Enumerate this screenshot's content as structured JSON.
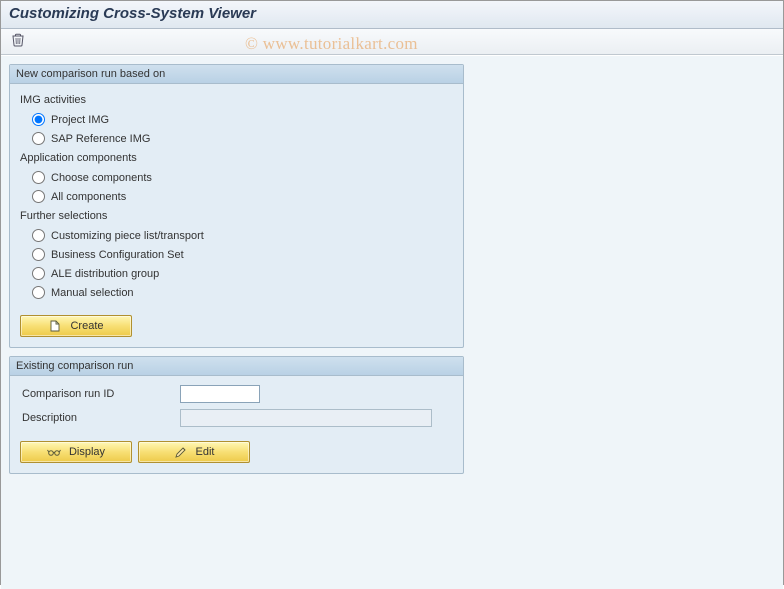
{
  "title": "Customizing Cross-System Viewer",
  "watermark": "© www.tutorialkart.com",
  "toolbar": {
    "delete_tooltip": "Delete"
  },
  "panels": {
    "new_run": {
      "header": "New comparison run based on",
      "groups": {
        "img_activities": {
          "label": "IMG activities",
          "options": {
            "project_img": "Project IMG",
            "sap_ref_img": "SAP Reference IMG"
          }
        },
        "app_components": {
          "label": "Application components",
          "options": {
            "choose": "Choose components",
            "all": "All components"
          }
        },
        "further": {
          "label": "Further selections",
          "options": {
            "piece_list": "Customizing piece list/transport",
            "bc_set": "Business Configuration Set",
            "ale_group": "ALE distribution group",
            "manual": "Manual selection"
          }
        }
      },
      "create_button": "Create"
    },
    "existing_run": {
      "header": "Existing comparison run",
      "fields": {
        "run_id": {
          "label": "Comparison run ID",
          "value": ""
        },
        "description": {
          "label": "Description",
          "value": ""
        }
      },
      "display_button": "Display",
      "edit_button": "Edit"
    }
  }
}
